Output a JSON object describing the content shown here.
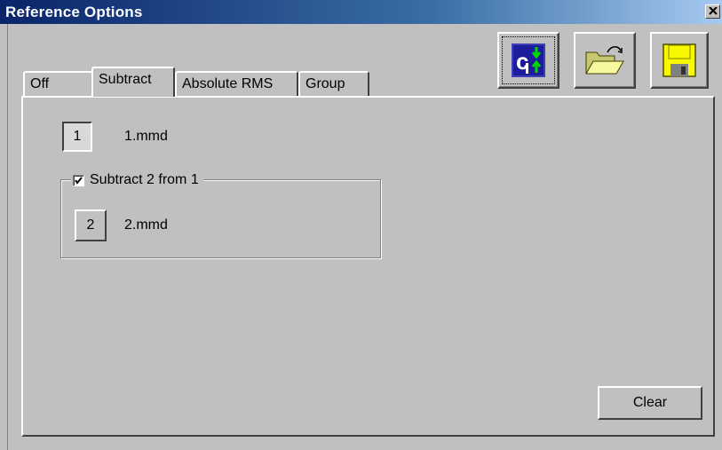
{
  "window": {
    "title": "Reference Options"
  },
  "toolbar": {
    "buttons": [
      {
        "icon": "reference-arrows-icon"
      },
      {
        "icon": "open-folder-icon"
      },
      {
        "icon": "save-disk-icon"
      }
    ]
  },
  "tabs": [
    {
      "label": "Off"
    },
    {
      "label": "Subtract",
      "active": true
    },
    {
      "label": "Absolute RMS"
    },
    {
      "label": "Group"
    }
  ],
  "subtract": {
    "ref1": {
      "button_label": "1",
      "file": "1.mmd"
    },
    "group": {
      "label": "Subtract 2 from 1",
      "checked": true
    },
    "ref2": {
      "button_label": "2",
      "file": "2.mmd"
    }
  },
  "clear_label": "Clear",
  "colors": {
    "titlebar": "#0a246a",
    "face": "#c0c0c0",
    "icon_bg": "#1c1c9c",
    "arrow": "#00d800",
    "folder": "#f8f8a0",
    "disk": "#f8f800"
  }
}
